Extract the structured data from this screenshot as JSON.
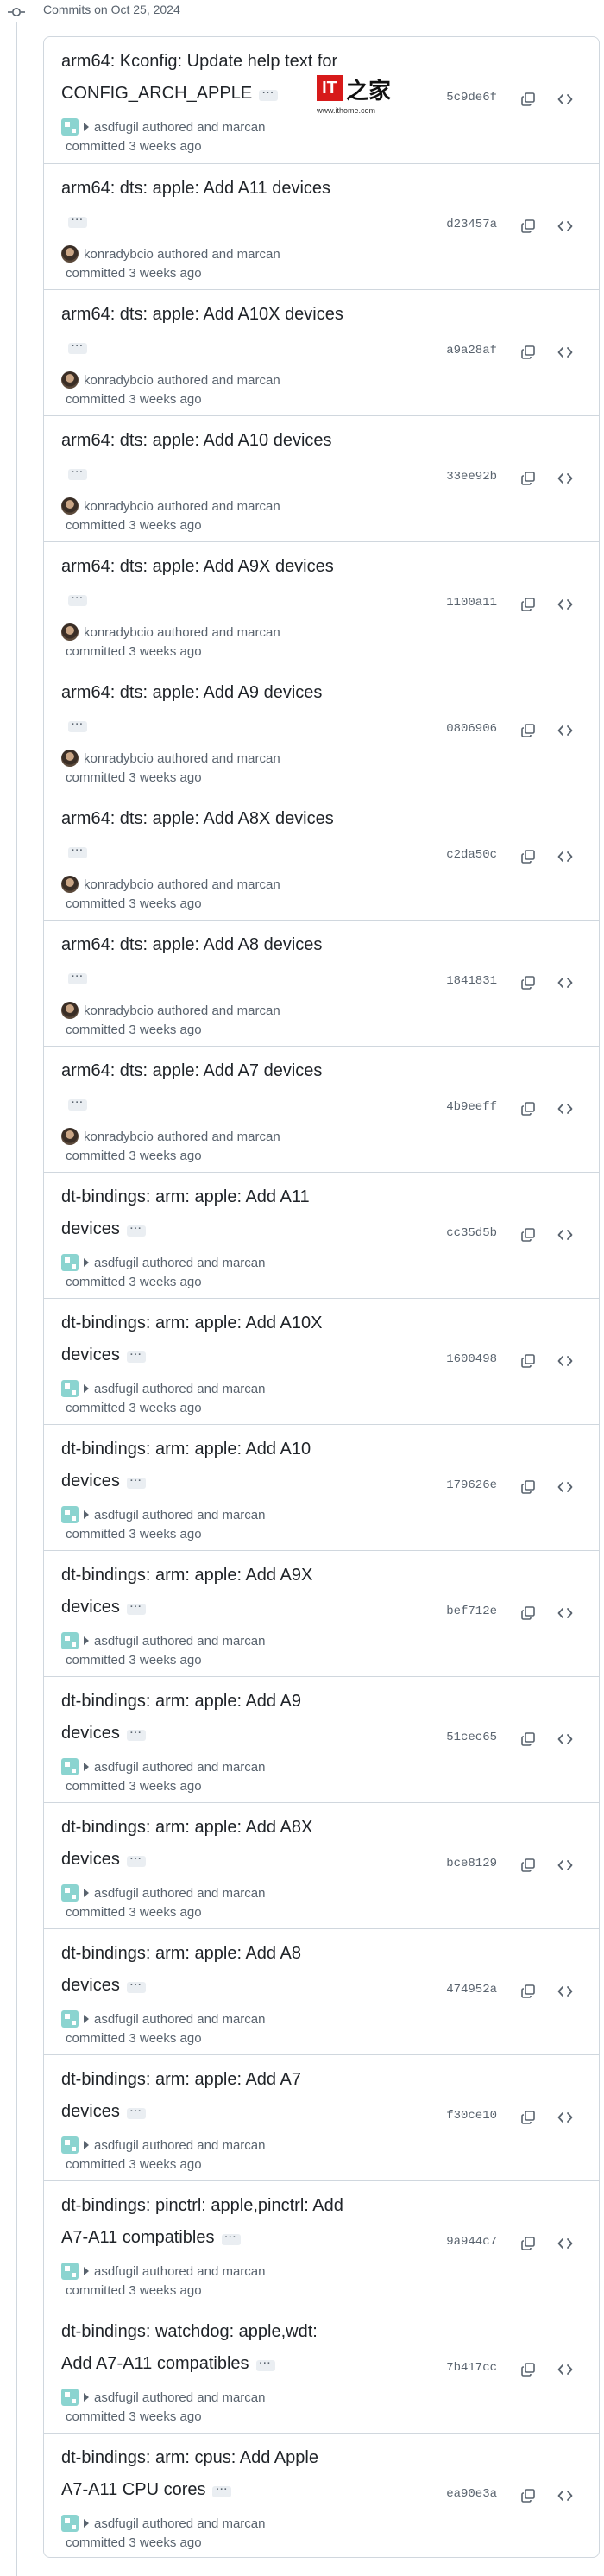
{
  "group": {
    "date_label": "Commits on Oct 25, 2024"
  },
  "watermark": {
    "site": "www.ithome.com",
    "letters": "IT",
    "chars": "之家"
  },
  "commits": [
    {
      "title": "arm64: Kconfig: Update help text for CONFIG_ARCH_APPLE",
      "author": "asdfugil",
      "avatar": "pixel",
      "byline": "authored and marcan",
      "committed": "committed 3 weeks ago",
      "sha": "5c9de6f"
    },
    {
      "title": "arm64: dts: apple: Add A11 devices",
      "author": "konradybcio",
      "avatar": "photo",
      "byline": "authored and marcan",
      "committed": "committed 3 weeks ago",
      "sha": "d23457a"
    },
    {
      "title": "arm64: dts: apple: Add A10X devices",
      "author": "konradybcio",
      "avatar": "photo",
      "byline": "authored and marcan",
      "committed": "committed 3 weeks ago",
      "sha": "a9a28af"
    },
    {
      "title": "arm64: dts: apple: Add A10 devices",
      "author": "konradybcio",
      "avatar": "photo",
      "byline": "authored and marcan",
      "committed": "committed 3 weeks ago",
      "sha": "33ee92b"
    },
    {
      "title": "arm64: dts: apple: Add A9X devices",
      "author": "konradybcio",
      "avatar": "photo",
      "byline": "authored and marcan",
      "committed": "committed 3 weeks ago",
      "sha": "1100a11"
    },
    {
      "title": "arm64: dts: apple: Add A9 devices",
      "author": "konradybcio",
      "avatar": "photo",
      "byline": "authored and marcan",
      "committed": "committed 3 weeks ago",
      "sha": "0806906"
    },
    {
      "title": "arm64: dts: apple: Add A8X devices",
      "author": "konradybcio",
      "avatar": "photo",
      "byline": "authored and marcan",
      "committed": "committed 3 weeks ago",
      "sha": "c2da50c"
    },
    {
      "title": "arm64: dts: apple: Add A8 devices",
      "author": "konradybcio",
      "avatar": "photo",
      "byline": "authored and marcan",
      "committed": "committed 3 weeks ago",
      "sha": "1841831"
    },
    {
      "title": "arm64: dts: apple: Add A7 devices",
      "author": "konradybcio",
      "avatar": "photo",
      "byline": "authored and marcan",
      "committed": "committed 3 weeks ago",
      "sha": "4b9eeff"
    },
    {
      "title": "dt-bindings: arm: apple: Add A11 devices",
      "author": "asdfugil",
      "avatar": "pixel",
      "byline": "authored and marcan",
      "committed": "committed 3 weeks ago",
      "sha": "cc35d5b"
    },
    {
      "title": "dt-bindings: arm: apple: Add A10X devices",
      "author": "asdfugil",
      "avatar": "pixel",
      "byline": "authored and marcan",
      "committed": "committed 3 weeks ago",
      "sha": "1600498"
    },
    {
      "title": "dt-bindings: arm: apple: Add A10 devices",
      "author": "asdfugil",
      "avatar": "pixel",
      "byline": "authored and marcan",
      "committed": "committed 3 weeks ago",
      "sha": "179626e"
    },
    {
      "title": "dt-bindings: arm: apple: Add A9X devices",
      "author": "asdfugil",
      "avatar": "pixel",
      "byline": "authored and marcan",
      "committed": "committed 3 weeks ago",
      "sha": "bef712e"
    },
    {
      "title": "dt-bindings: arm: apple: Add A9 devices",
      "author": "asdfugil",
      "avatar": "pixel",
      "byline": "authored and marcan",
      "committed": "committed 3 weeks ago",
      "sha": "51cec65"
    },
    {
      "title": "dt-bindings: arm: apple: Add A8X devices",
      "author": "asdfugil",
      "avatar": "pixel",
      "byline": "authored and marcan",
      "committed": "committed 3 weeks ago",
      "sha": "bce8129"
    },
    {
      "title": "dt-bindings: arm: apple: Add A8 devices",
      "author": "asdfugil",
      "avatar": "pixel",
      "byline": "authored and marcan",
      "committed": "committed 3 weeks ago",
      "sha": "474952a"
    },
    {
      "title": "dt-bindings: arm: apple: Add A7 devices",
      "author": "asdfugil",
      "avatar": "pixel",
      "byline": "authored and marcan",
      "committed": "committed 3 weeks ago",
      "sha": "f30ce10"
    },
    {
      "title": "dt-bindings: pinctrl: apple,pinctrl: Add A7-A11 compatibles",
      "author": "asdfugil",
      "avatar": "pixel",
      "byline": "authored and marcan",
      "committed": "committed 3 weeks ago",
      "sha": "9a944c7"
    },
    {
      "title": "dt-bindings: watchdog: apple,wdt: Add A7-A11 compatibles",
      "author": "asdfugil",
      "avatar": "pixel",
      "byline": "authored and marcan",
      "committed": "committed 3 weeks ago",
      "sha": "7b417cc"
    },
    {
      "title": "dt-bindings: arm: cpus: Add Apple A7-A11 CPU cores",
      "author": "asdfugil",
      "avatar": "pixel",
      "byline": "authored and marcan",
      "committed": "committed 3 weeks ago",
      "sha": "ea90e3a"
    }
  ]
}
